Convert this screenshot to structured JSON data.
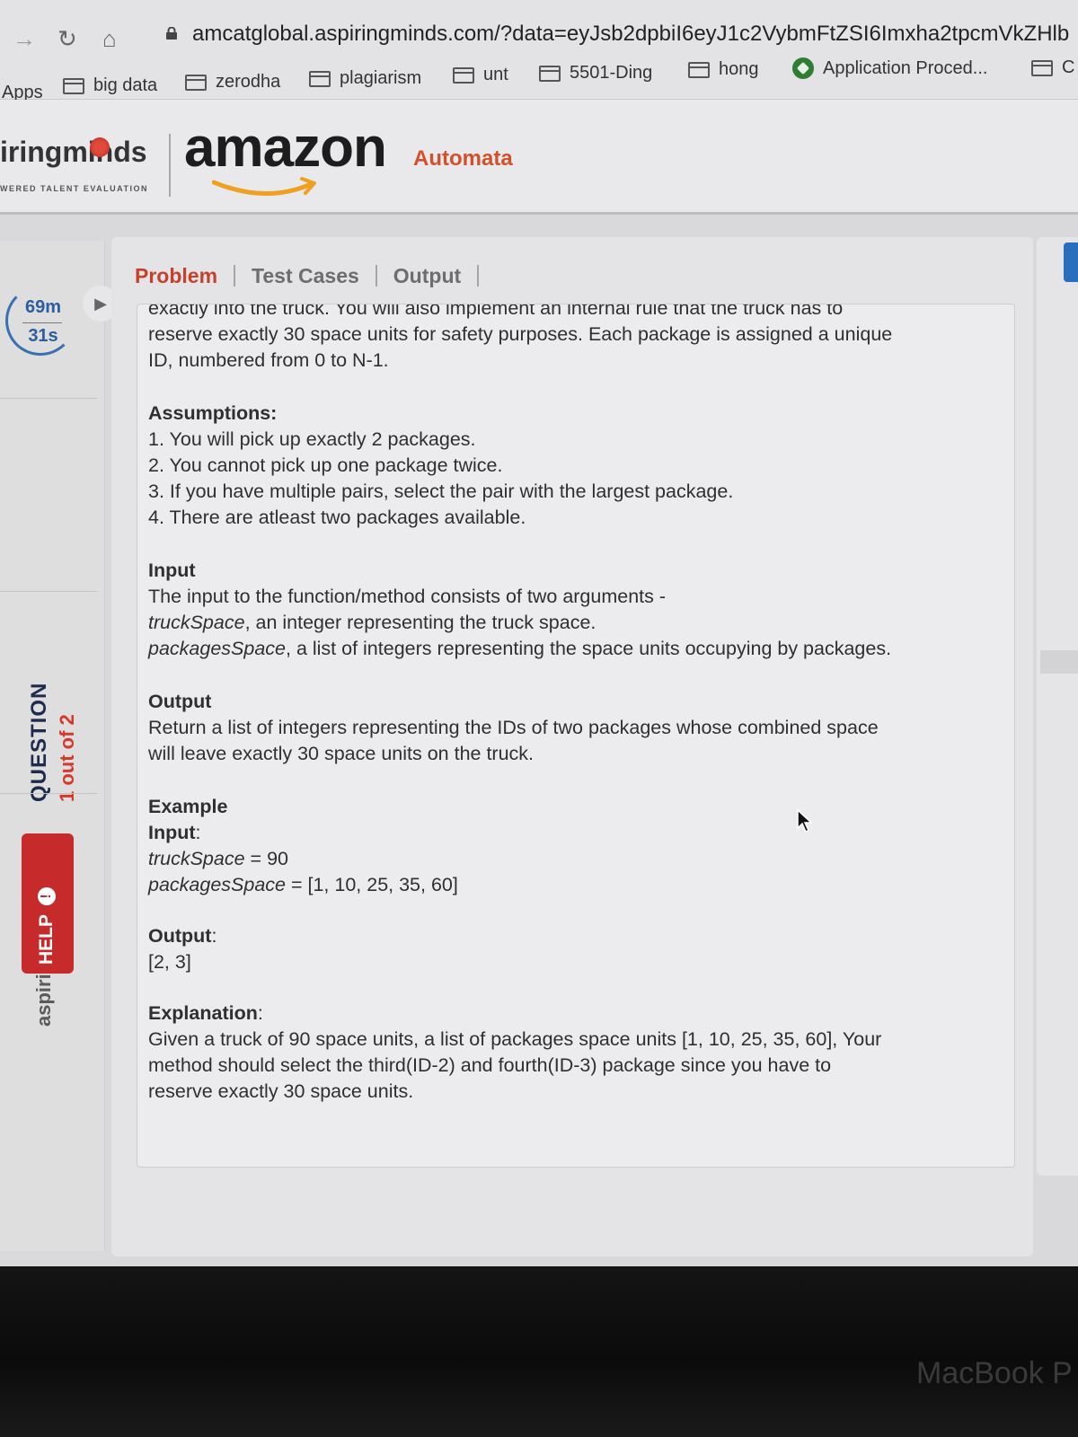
{
  "browser": {
    "url": "amcatglobal.aspiringminds.com/?data=eyJsb2dpbiI6eyJ1c2VybmFtZSI6Imxha2tpcmVkZHlb",
    "bookmarks": [
      "Apps",
      "big data",
      "zerodha",
      "plagiarism",
      "unt",
      "5501-Ding",
      "hong",
      "Application Proced...",
      "C"
    ]
  },
  "header": {
    "brand": "iringminds",
    "brand_tagline": "WERED TALENT EVALUATION",
    "partner_logo": "amazon",
    "product": "Automata"
  },
  "sidebar": {
    "timer_minutes": "69m",
    "timer_seconds": "31s",
    "question_label": "QUESTION",
    "question_count": "1 out of 2",
    "brand_vertical": "aspiringminds",
    "help_label": "HELP"
  },
  "tabs": [
    "Problem",
    "Test Cases",
    "Output"
  ],
  "problem": {
    "cut_line": "exactly into the truck. You will also implement an internal rule that the truck has to",
    "intro": [
      "reserve exactly 30 space units for safety purposes. Each package is assigned a unique",
      "ID, numbered from 0 to N-1."
    ],
    "assumptions_title": "Assumptions:",
    "assumptions": [
      "1. You will pick up exactly 2 packages.",
      "2. You cannot pick up one package twice.",
      "3. If you have multiple pairs, select the pair with the largest package.",
      "4. There are atleast two packages available."
    ],
    "input_title": "Input",
    "input_desc": "The input to the function/method consists of two arguments -",
    "input_arg1_name": "truckSpace",
    "input_arg1_desc": ", an integer representing the truck space.",
    "input_arg2_name": "packagesSpace",
    "input_arg2_desc": ", a list of integers representing the space units occupying by packages.",
    "output_title": "Output",
    "output_desc": [
      "Return a list of integers representing the IDs of two packages whose combined space",
      "will leave exactly 30 space units on the truck."
    ],
    "example_title": "Example",
    "example_input_label": "Input",
    "example_colon": ":",
    "example_truck": "truckSpace",
    "example_truck_value": " = 90",
    "example_packages": "packagesSpace",
    "example_packages_value": " = [1, 10, 25, 35, 60]",
    "example_output_label": "Output",
    "example_output_value": "[2, 3]",
    "explanation_title": "Explanation",
    "explanation": [
      "Given a truck of 90 space units, a list of packages space units [1, 10, 25, 35, 60], Your",
      "method should select the third(ID-2) and fourth(ID-3) package since you have to",
      "reserve exactly 30 space units."
    ]
  },
  "bezel_label": "MacBook P",
  "colors": {
    "accent": "#c6402a",
    "timer": "#2c5d9e",
    "help": "#c62a2a",
    "product": "#d2502a"
  }
}
